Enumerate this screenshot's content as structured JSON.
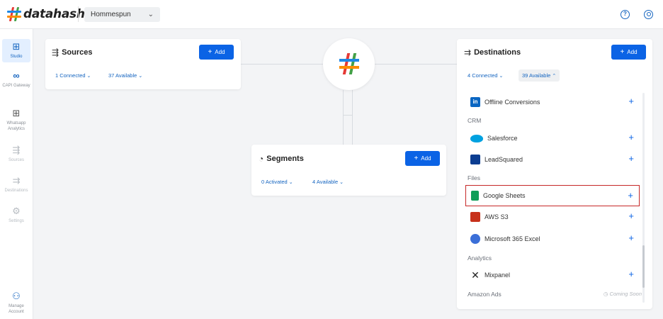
{
  "header": {
    "logo_text": "datahash",
    "workspace": "Hommespun",
    "help_icon": "help-icon",
    "user_icon": "user-icon"
  },
  "sidebar": {
    "items": [
      {
        "label": "Studio",
        "icon": "studio-icon",
        "active": true
      },
      {
        "label": "CAPI Gateway",
        "icon": "meta-icon"
      },
      {
        "label": "Whatsapp Analytics",
        "icon": "whatsapp-analytics-icon"
      },
      {
        "label": "Sources",
        "icon": "sources-icon"
      },
      {
        "label": "Destinations",
        "icon": "destinations-icon"
      },
      {
        "label": "Settings",
        "icon": "settings-icon"
      },
      {
        "label": "Manage Account",
        "icon": "manage-account-icon"
      }
    ]
  },
  "sources": {
    "title": "Sources",
    "add_label": "Add",
    "connected": "1 Connected",
    "available": "37 Available"
  },
  "segments": {
    "title": "Segments",
    "add_label": "Add",
    "activated": "0 Activated",
    "available": "4 Available"
  },
  "destinations": {
    "title": "Destinations",
    "add_label": "Add",
    "connected": "4 Connected",
    "available": "39 Available",
    "rows": [
      {
        "type": "item",
        "label": "Offline Conversions",
        "icon": "linkedin-icon",
        "color": "#0a66c2"
      },
      {
        "type": "section",
        "label": "CRM"
      },
      {
        "type": "item",
        "label": "Salesforce",
        "icon": "salesforce-icon",
        "color": "#00a1e0"
      },
      {
        "type": "item",
        "label": "LeadSquared",
        "icon": "leadsquared-icon",
        "color": "#0b3d91"
      },
      {
        "type": "section",
        "label": "Files"
      },
      {
        "type": "item",
        "label": "Google Sheets",
        "icon": "google-sheets-icon",
        "color": "#0f9d58",
        "highlight": true
      },
      {
        "type": "item",
        "label": "AWS S3",
        "icon": "aws-s3-icon",
        "color": "#c7311b"
      },
      {
        "type": "item",
        "label": "Microsoft 365 Excel",
        "icon": "microsoft-365-icon",
        "color": "#3b6fd8"
      },
      {
        "type": "section",
        "label": "Analytics"
      },
      {
        "type": "item",
        "label": "Mixpanel",
        "icon": "mixpanel-icon",
        "color": "#222222"
      },
      {
        "type": "section",
        "label": "Amazon Ads",
        "badge": "Coming Soon"
      }
    ]
  },
  "colors": {
    "accent": "#0b63e5",
    "highlight_border": "#c62828"
  }
}
